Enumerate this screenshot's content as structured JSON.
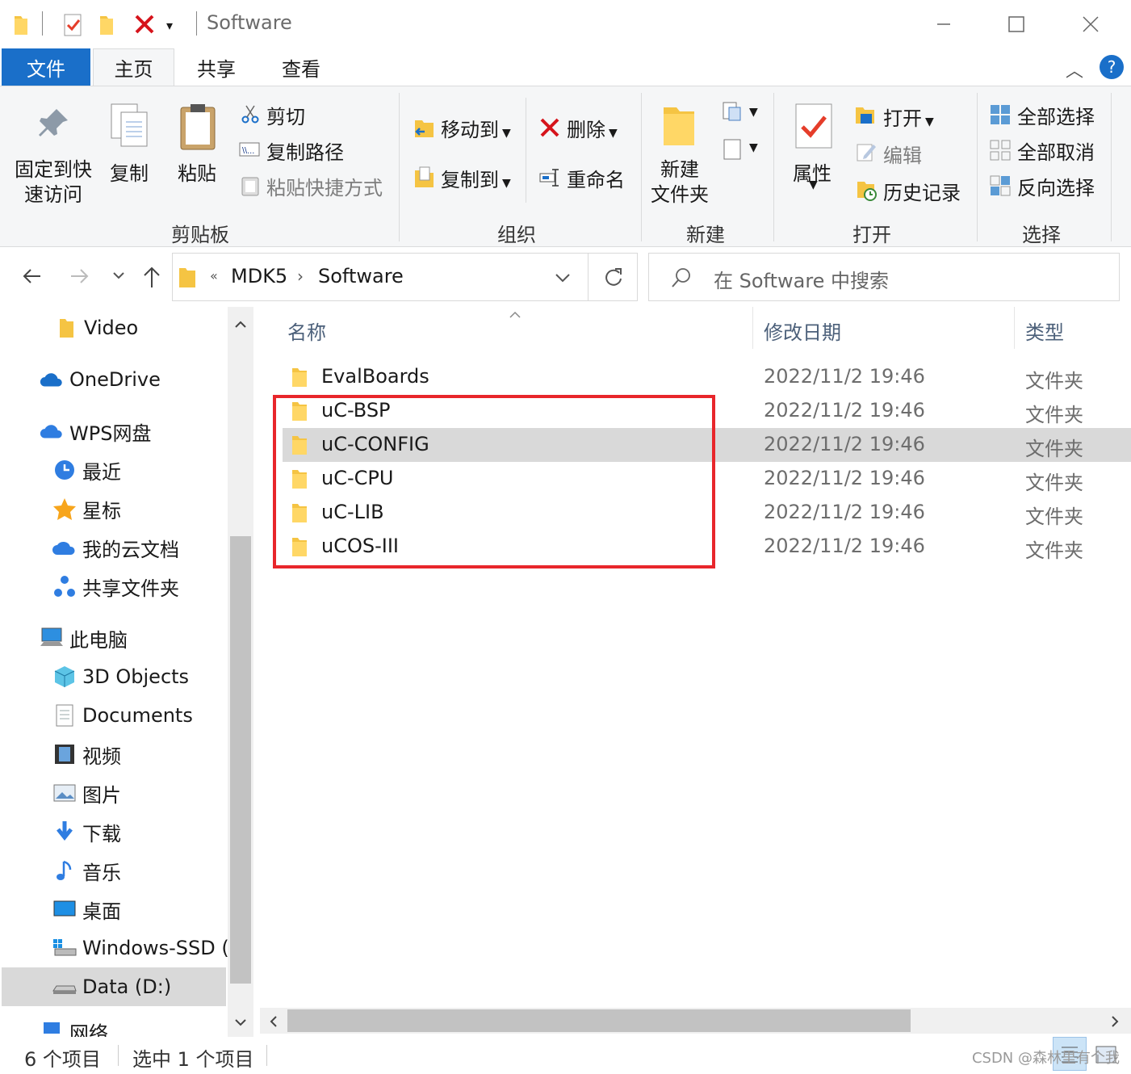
{
  "window": {
    "title": "Software",
    "minimize_icon": "minimize-icon",
    "maximize_icon": "maximize-icon",
    "close_icon": "close-icon"
  },
  "ribbon_tabs": [
    "文件",
    "主页",
    "共享",
    "查看"
  ],
  "ribbon": {
    "clipboard": {
      "pin_label": "固定到快\n速访问",
      "copy_label": "复制",
      "paste_label": "粘贴",
      "cut_label": "剪切",
      "copy_path_label": "复制路径",
      "paste_shortcut_label": "粘贴快捷方式",
      "group_label": "剪贴板"
    },
    "organize": {
      "move_to_label": "移动到",
      "copy_to_label": "复制到",
      "delete_label": "删除",
      "rename_label": "重命名",
      "group_label": "组织"
    },
    "new": {
      "new_folder_label": "新建\n文件夹",
      "group_label": "新建"
    },
    "open": {
      "properties_label": "属性",
      "open_label": "打开",
      "edit_label": "编辑",
      "history_label": "历史记录",
      "group_label": "打开"
    },
    "select": {
      "select_all_label": "全部选择",
      "select_none_label": "全部取消",
      "invert_label": "反向选择",
      "group_label": "选择"
    }
  },
  "nav": {
    "breadcrumb_overflow": "«",
    "breadcrumb": [
      "MDK5",
      "Software"
    ],
    "search_placeholder": "在 Software 中搜索"
  },
  "sidebar": {
    "items": [
      {
        "label": "Video",
        "icon": "folder-icon"
      },
      {
        "label": "OneDrive",
        "icon": "onedrive-icon"
      },
      {
        "label": "WPS网盘",
        "icon": "wps-cloud-icon"
      },
      {
        "label": "最近",
        "icon": "clock-icon"
      },
      {
        "label": "星标",
        "icon": "star-icon"
      },
      {
        "label": "我的云文档",
        "icon": "cloud-doc-icon"
      },
      {
        "label": "共享文件夹",
        "icon": "share-folder-icon"
      },
      {
        "label": "此电脑",
        "icon": "this-pc-icon"
      },
      {
        "label": "3D Objects",
        "icon": "3d-objects-icon"
      },
      {
        "label": "Documents",
        "icon": "documents-icon"
      },
      {
        "label": "视频",
        "icon": "video-icon"
      },
      {
        "label": "图片",
        "icon": "pictures-icon"
      },
      {
        "label": "下载",
        "icon": "download-icon"
      },
      {
        "label": "音乐",
        "icon": "music-icon"
      },
      {
        "label": "桌面",
        "icon": "desktop-icon"
      },
      {
        "label": "Windows-SSD (",
        "icon": "windows-drive-icon"
      },
      {
        "label": "Data (D:)",
        "icon": "drive-icon"
      },
      {
        "label": "网络",
        "icon": "network-icon"
      }
    ]
  },
  "columns": {
    "name": "名称",
    "date": "修改日期",
    "type": "类型"
  },
  "files": [
    {
      "name": "EvalBoards",
      "date": "2022/11/2 19:46",
      "type": "文件夹"
    },
    {
      "name": "uC-BSP",
      "date": "2022/11/2 19:46",
      "type": "文件夹"
    },
    {
      "name": "uC-CONFIG",
      "date": "2022/11/2 19:46",
      "type": "文件夹"
    },
    {
      "name": "uC-CPU",
      "date": "2022/11/2 19:46",
      "type": "文件夹"
    },
    {
      "name": "uC-LIB",
      "date": "2022/11/2 19:46",
      "type": "文件夹"
    },
    {
      "name": "uCOS-III",
      "date": "2022/11/2 19:46",
      "type": "文件夹"
    }
  ],
  "status": {
    "item_count": "6 个项目",
    "selected_count": "选中 1 个项目"
  },
  "watermark": "CSDN @森林里有个我",
  "colors": {
    "accent": "#1a6fc9",
    "highlight_box": "#e8262b",
    "selected_row": "#d9d9d9"
  }
}
